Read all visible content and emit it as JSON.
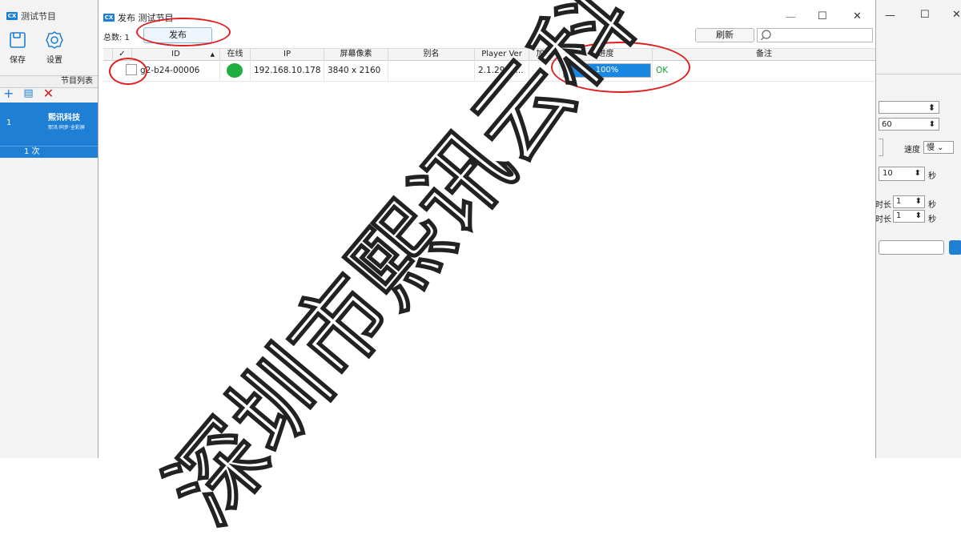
{
  "main_window": {
    "title": "测试节目",
    "logo_text": "CX",
    "toolbar": {
      "save_label": "保存",
      "settings_label": "设置"
    },
    "program_list_title": "节目列表",
    "list_actions": [
      "+",
      "▤",
      "✕"
    ],
    "program_item": {
      "index": "1",
      "brand": "熙讯科技",
      "subtitle": "熙讯·同步·全彩屏",
      "play_count": "1 次"
    },
    "window_controls": {
      "minimize": "—",
      "maximize": "☐",
      "close": "✕"
    }
  },
  "right_panel": {
    "value_60": "60",
    "speed_label": "速度",
    "speed_value": "慢",
    "duration_value": "10",
    "sec": "秒",
    "len1_label": "时长",
    "len1_value": "1",
    "len2_label": "时长",
    "len2_value": "1"
  },
  "dialog": {
    "logo_text": "CX",
    "title": "发布 测试节目",
    "total_label": "总数: 1",
    "publish_label": "发布",
    "refresh_label": "刷新",
    "search_placeholder": "",
    "window_controls": {
      "minimize": "—",
      "maximize": "☐",
      "close": "✕"
    },
    "columns": {
      "check": "✓",
      "id": "ID",
      "sort_arrow": "▲",
      "online": "在线",
      "ip": "IP",
      "resolution": "屏幕像素",
      "alias": "别名",
      "player_ver": "Player Ver",
      "encrypt": "加密",
      "progress": "进度",
      "note": "备注"
    },
    "rows": [
      {
        "checked": false,
        "id": "g2-b24-00006",
        "online_color": "#1fae3f",
        "ip": "192.168.10.178",
        "resolution": "3840 x 2160",
        "alias": "",
        "player_ver": "2.1.29-la...",
        "encrypt": "",
        "progress_value": 100,
        "progress_text": "100%",
        "status": "OK",
        "note": ""
      }
    ]
  },
  "watermark": "深圳市熙讯云科",
  "colors": {
    "accent": "#1f7fd5",
    "progress": "#1a88e0",
    "ok_text": "#1aa33a",
    "annotation": "#e02020"
  }
}
